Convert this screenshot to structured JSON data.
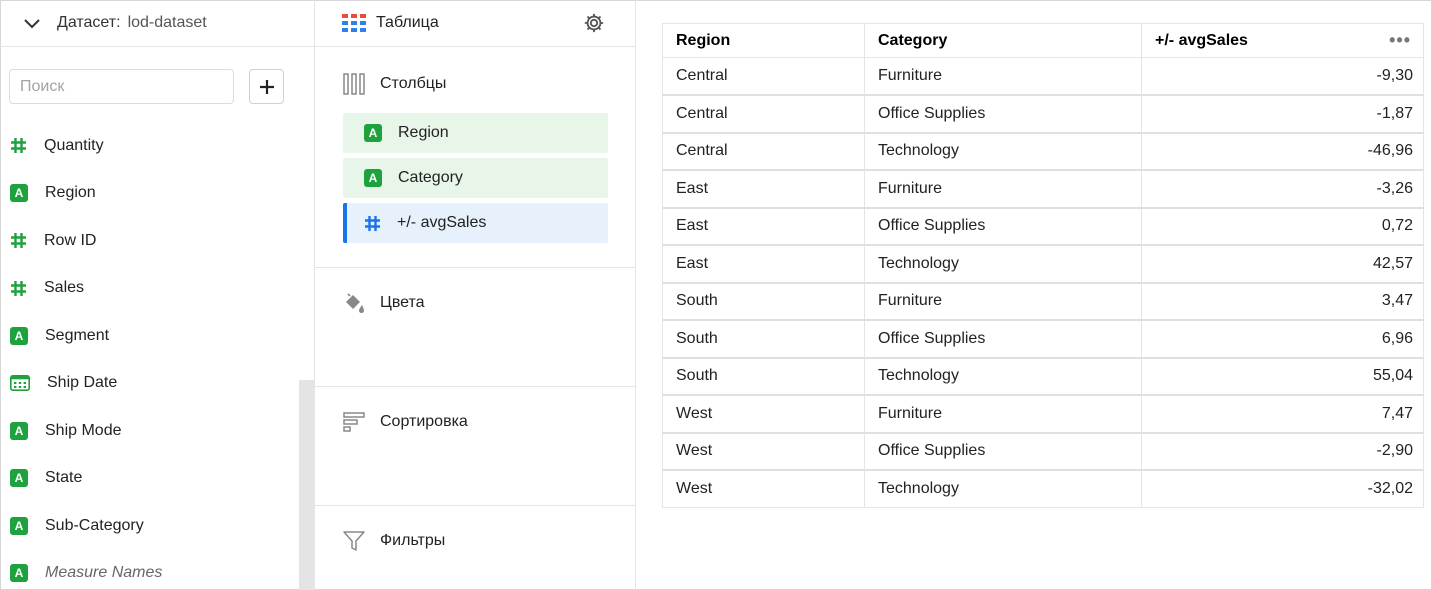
{
  "dataset": {
    "label": "Датасет:",
    "name": "lod-dataset",
    "search_placeholder": "Поиск",
    "fields": [
      {
        "type": "measure",
        "label": "Quantity",
        "italic": false
      },
      {
        "type": "dimension",
        "label": "Region",
        "italic": false
      },
      {
        "type": "measure",
        "label": "Row ID",
        "italic": false
      },
      {
        "type": "measure",
        "label": "Sales",
        "italic": false
      },
      {
        "type": "dimension",
        "label": "Segment",
        "italic": false
      },
      {
        "type": "date",
        "label": "Ship Date",
        "italic": false
      },
      {
        "type": "dimension",
        "label": "Ship Mode",
        "italic": false
      },
      {
        "type": "dimension",
        "label": "State",
        "italic": false
      },
      {
        "type": "dimension",
        "label": "Sub-Category",
        "italic": false
      },
      {
        "type": "dimension",
        "label": "Measure Names",
        "italic": true
      }
    ]
  },
  "visualization": {
    "type_label": "Таблица",
    "sections": {
      "columns": "Столбцы",
      "colors": "Цвета",
      "sort": "Сортировка",
      "filters": "Фильтры"
    },
    "column_chips": [
      {
        "type": "dimension",
        "label": "Region"
      },
      {
        "type": "dimension",
        "label": "Category"
      },
      {
        "type": "measure",
        "label": "+/- avgSales"
      }
    ]
  },
  "table": {
    "headers": [
      "Region",
      "Category",
      "+/- avgSales"
    ],
    "more_label": "•••",
    "rows": [
      [
        "Central",
        "Furniture",
        "-9,30"
      ],
      [
        "Central",
        "Office Supplies",
        "-1,87"
      ],
      [
        "Central",
        "Technology",
        "-46,96"
      ],
      [
        "East",
        "Furniture",
        "-3,26"
      ],
      [
        "East",
        "Office Supplies",
        "0,72"
      ],
      [
        "East",
        "Technology",
        "42,57"
      ],
      [
        "South",
        "Furniture",
        "3,47"
      ],
      [
        "South",
        "Office Supplies",
        "6,96"
      ],
      [
        "South",
        "Technology",
        "55,04"
      ],
      [
        "West",
        "Furniture",
        "7,47"
      ],
      [
        "West",
        "Office Supplies",
        "-2,90"
      ],
      [
        "West",
        "Technology",
        "-32,02"
      ]
    ]
  },
  "colors": {
    "dimension": "#1ea23e",
    "measure_icon_left": "#1ea23e",
    "measure_icon_chip": "#1a73e8",
    "accent": "#1a73e8"
  }
}
